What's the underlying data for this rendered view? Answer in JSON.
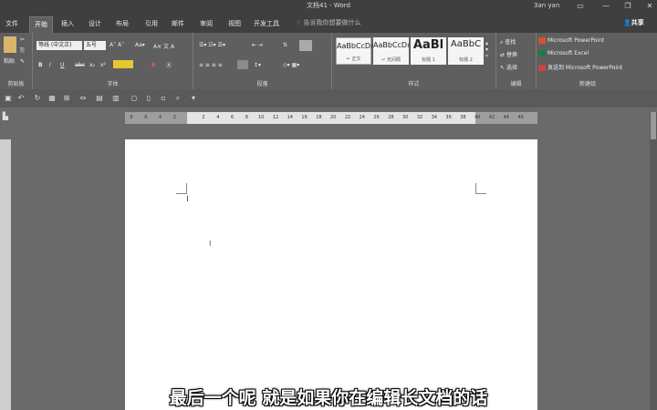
{
  "window": {
    "title": "文档41 - Word",
    "user": "3an yan",
    "controls": [
      "▭",
      "—",
      "❐",
      "✕"
    ]
  },
  "tabs": [
    "文件",
    "开始",
    "插入",
    "设计",
    "布局",
    "引用",
    "邮件",
    "审阅",
    "视图",
    "开发工具"
  ],
  "active_tab": "开始",
  "tell_me": "告诉我你想要做什么",
  "share": "共享",
  "ribbon": {
    "clipboard": {
      "paste": "粘贴",
      "label": "剪贴板"
    },
    "font": {
      "name": "等线 (中文正)",
      "size": "五号",
      "label": "字体",
      "row2": [
        "B",
        "I",
        "U",
        "abc",
        "x₂",
        "x²",
        "A"
      ]
    },
    "paragraph": {
      "label": "段落"
    },
    "styles": {
      "label": "样式",
      "items": [
        {
          "sample": "AaBbCcDı",
          "name": "↵ 正文"
        },
        {
          "sample": "AaBbCcDı",
          "name": "↵ 无间隔"
        },
        {
          "sample": "AaBl",
          "name": "标题 1"
        },
        {
          "sample": "AaBbC",
          "name": "标题 2"
        }
      ]
    },
    "editing": {
      "label": "编辑",
      "find": "查找",
      "replace": "替换",
      "select": "选择"
    },
    "new_group": {
      "label": "新建组",
      "items": [
        "Microsoft PowerPoint",
        "Microsoft Excel",
        "发送到 Microsoft PowerPoint"
      ]
    }
  },
  "ruler": {
    "numbers": [
      "8",
      "6",
      "4",
      "2",
      "",
      "2",
      "4",
      "6",
      "8",
      "10",
      "12",
      "14",
      "16",
      "18",
      "20",
      "22",
      "24",
      "26",
      "28",
      "30",
      "32",
      "34",
      "36",
      "38",
      "40",
      "42",
      "44",
      "46"
    ]
  },
  "subtitle": "最后一个呢 就是如果你在编辑长文档的话"
}
